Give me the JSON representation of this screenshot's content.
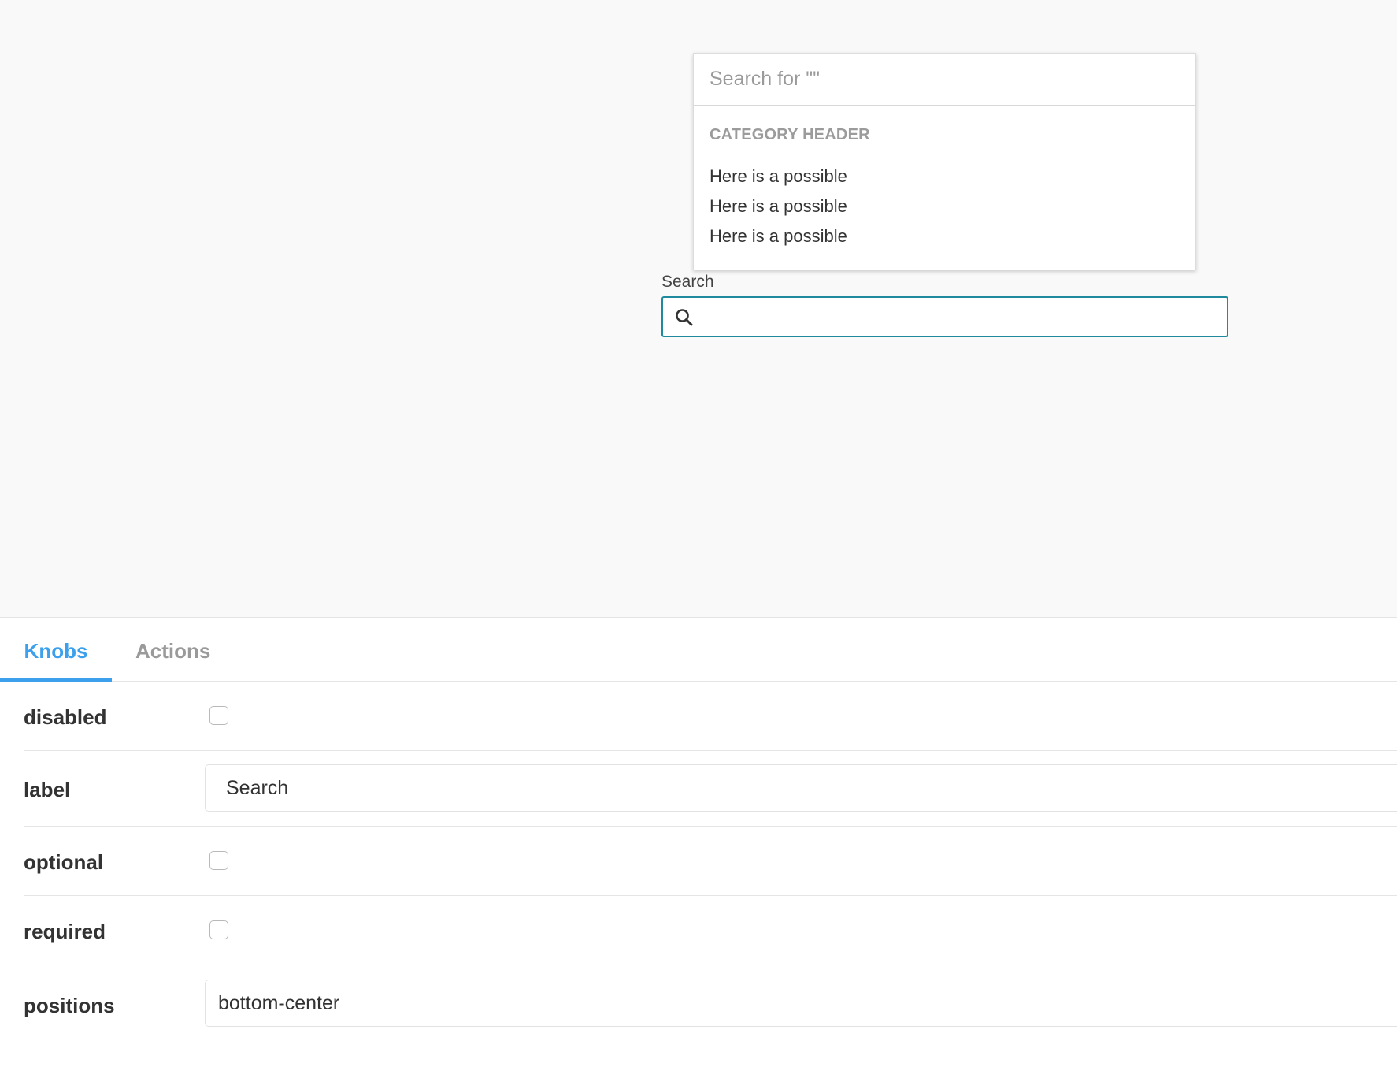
{
  "preview": {
    "dropdown": {
      "search_placeholder": "Search for \"\"",
      "category_header": "CATEGORY HEADER",
      "options": [
        "Here is a possible",
        "Here is a possible",
        "Here is a possible"
      ]
    },
    "search_field": {
      "label": "Search",
      "value": "",
      "icon": "search-icon",
      "focus_color": "#1f8a9e"
    }
  },
  "panel": {
    "tabs": [
      {
        "label": "Knobs",
        "active": true
      },
      {
        "label": "Actions",
        "active": false
      }
    ],
    "active_tab_color": "#3ca0ec",
    "knobs": {
      "disabled": {
        "name": "disabled",
        "checked": false
      },
      "label": {
        "name": "label",
        "value": "Search"
      },
      "optional": {
        "name": "optional",
        "checked": false
      },
      "required": {
        "name": "required",
        "checked": false
      },
      "positions": {
        "name": "positions",
        "value": "bottom-center"
      }
    }
  }
}
